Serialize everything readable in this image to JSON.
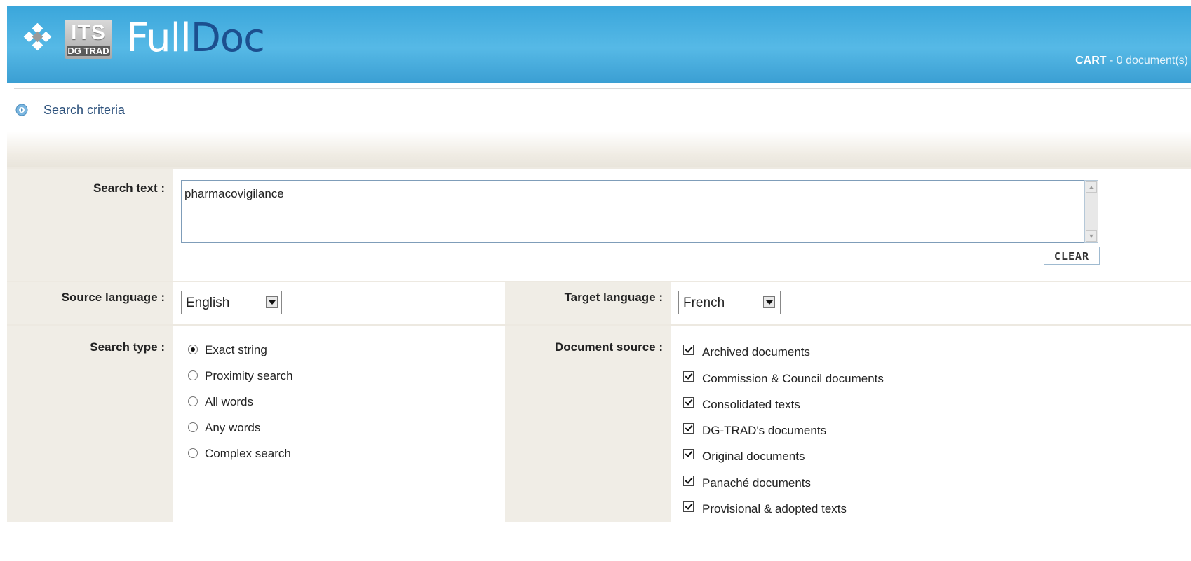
{
  "header": {
    "logo_its": "ITS",
    "logo_sub": "DG TRAD",
    "app_name_part1": "Full",
    "app_name_part2": "Doc",
    "cart_label": "CART",
    "cart_count": " - 0 document(s)"
  },
  "criteria": {
    "title": "Search criteria"
  },
  "search": {
    "label": "Search text :",
    "value": "pharmacovigilance",
    "clear_label": "CLEAR"
  },
  "languages": {
    "source_label": "Source language :",
    "source_value": "English",
    "target_label": "Target language :",
    "target_value": "French"
  },
  "search_type": {
    "label": "Search type :",
    "options": [
      {
        "label": "Exact string",
        "selected": true
      },
      {
        "label": "Proximity search",
        "selected": false
      },
      {
        "label": "All words",
        "selected": false
      },
      {
        "label": "Any words",
        "selected": false
      },
      {
        "label": "Complex search",
        "selected": false
      }
    ]
  },
  "document_source": {
    "label": "Document source :",
    "options": [
      {
        "label": "Archived documents",
        "checked": true
      },
      {
        "label": "Commission & Council documents",
        "checked": true
      },
      {
        "label": "Consolidated texts",
        "checked": true
      },
      {
        "label": "DG-TRAD's documents",
        "checked": true
      },
      {
        "label": "Original documents",
        "checked": true
      },
      {
        "label": "Panaché documents",
        "checked": true
      },
      {
        "label": "Provisional & adopted texts",
        "checked": true
      }
    ]
  },
  "colors": {
    "header_blue": "#4fb3e3",
    "doc_dark_blue": "#1c4f8f",
    "label_column": "#f0ede6"
  }
}
